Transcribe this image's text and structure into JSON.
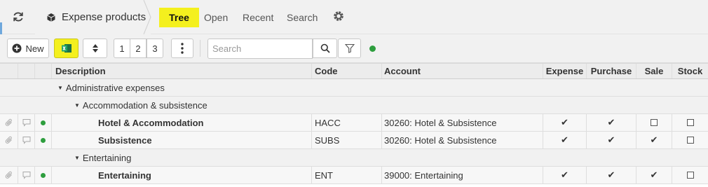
{
  "header": {
    "breadcrumb": "Expense products",
    "tabs": [
      "Tree",
      "Open",
      "Recent",
      "Search"
    ]
  },
  "toolbar": {
    "new_label": "New",
    "levels": [
      "1",
      "2",
      "3"
    ],
    "search_placeholder": "Search"
  },
  "grid": {
    "columns": [
      "Description",
      "Code",
      "Account",
      "Expense",
      "Purchase",
      "Sale",
      "Stock"
    ],
    "groups": {
      "admin": "Administrative expenses",
      "accommodation": "Accommodation & subsistence",
      "entertaining": "Entertaining"
    },
    "rows": [
      {
        "description": "Hotel & Accommodation",
        "code": "HACC",
        "account": "30260: Hotel & Subsistence",
        "expense": true,
        "purchase": true,
        "sale": false,
        "stock": false
      },
      {
        "description": "Subsistence",
        "code": "SUBS",
        "account": "30260: Hotel & Subsistence",
        "expense": true,
        "purchase": true,
        "sale": true,
        "stock": false
      },
      {
        "description": "Entertaining",
        "code": "ENT",
        "account": "39000: Entertaining",
        "expense": true,
        "purchase": true,
        "sale": true,
        "stock": false
      }
    ]
  },
  "colors": {
    "highlight": "#f4f01e",
    "status_green": "#2e9e3e"
  },
  "icons": {
    "refresh": "refresh-icon",
    "breadcrumb": "cube-icon",
    "settings": "gear-icon",
    "new": "plus-circle-icon",
    "excel": "excel-icon",
    "sort": "sort-updown-icon",
    "more": "vertical-ellipsis-icon",
    "search": "search-icon",
    "filter": "filter-icon",
    "attachment": "paperclip-icon",
    "comment": "comment-icon",
    "status": "status-dot-icon"
  }
}
